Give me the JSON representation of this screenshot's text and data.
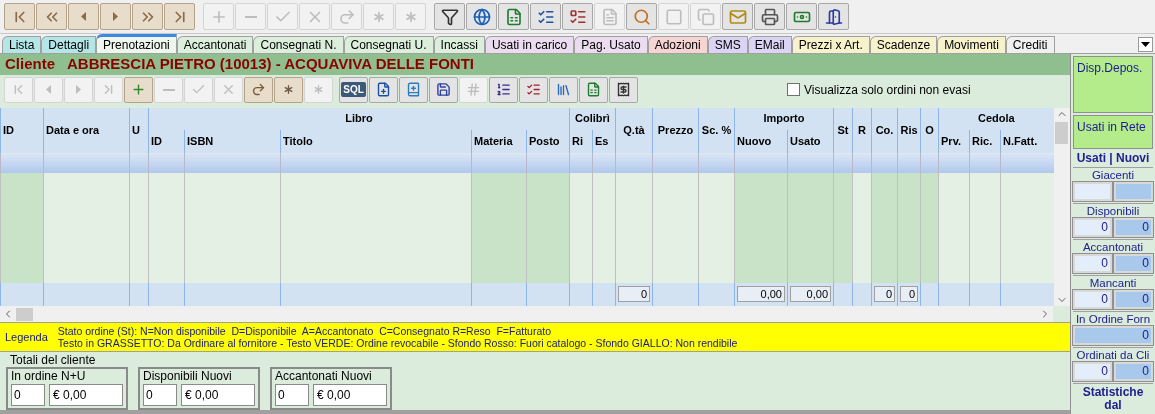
{
  "toolbar": {
    "buttons": [
      {
        "disabled": false
      },
      {
        "disabled": false
      },
      {
        "disabled": false
      },
      {
        "disabled": false
      },
      {
        "disabled": false
      },
      {
        "disabled": false
      },
      {
        "disabled": true
      },
      {
        "disabled": true
      },
      {
        "disabled": true
      },
      {
        "disabled": true
      },
      {
        "disabled": true
      },
      {
        "disabled": true
      },
      {
        "disabled": true
      },
      {
        "disabled": false
      },
      {
        "disabled": false
      },
      {
        "disabled": false
      },
      {
        "disabled": false
      },
      {
        "disabled": false
      },
      {
        "disabled": true
      },
      {
        "disabled": false
      },
      {
        "disabled": true
      },
      {
        "disabled": true
      },
      {
        "disabled": false
      },
      {
        "disabled": false
      },
      {
        "disabled": false
      },
      {
        "disabled": false
      }
    ]
  },
  "tabs": [
    {
      "label": "Lista",
      "selected": false,
      "color": "#b4e6e8"
    },
    {
      "label": "Dettagli",
      "selected": false,
      "color": "#b4e6e8"
    },
    {
      "label": "Prenotazioni",
      "selected": true,
      "color": "#eef6ee"
    },
    {
      "label": "Accantonati",
      "selected": false,
      "color": "#dcefdc"
    },
    {
      "label": "Consegnati N.",
      "selected": false,
      "color": "#dcefdc"
    },
    {
      "label": "Consegnati U.",
      "selected": false,
      "color": "#dcefdc"
    },
    {
      "label": "Incassi",
      "selected": false,
      "color": "#dcefdc"
    },
    {
      "label": "Usati in carico",
      "selected": false,
      "color": "#ecdcf0"
    },
    {
      "label": "Pag. Usato",
      "selected": false,
      "color": "#ecdcf0"
    },
    {
      "label": "Adozioni",
      "selected": false,
      "color": "#f6d4d4"
    },
    {
      "label": "SMS",
      "selected": false,
      "color": "#dcd4f4"
    },
    {
      "label": "EMail",
      "selected": false,
      "color": "#dcd4f4"
    },
    {
      "label": "Prezzi x Art.",
      "selected": false,
      "color": "#f6f2cc"
    },
    {
      "label": "Scadenze",
      "selected": false,
      "color": "#f6f2cc"
    },
    {
      "label": "Movimenti",
      "selected": false,
      "color": "#f6f2cc"
    },
    {
      "label": "Crediti",
      "selected": false,
      "color": "#f0f0f0"
    }
  ],
  "header": {
    "label": "Cliente",
    "customer": "ABBRESCIA PIETRO (10013) - ACQUAVIVA DELLE FONTI"
  },
  "record_toolbar": {
    "buttons": [
      {
        "disabled": true
      },
      {
        "disabled": true
      },
      {
        "disabled": true
      },
      {
        "disabled": true
      },
      {
        "disabled": false
      },
      {
        "disabled": true
      },
      {
        "disabled": true
      },
      {
        "disabled": true
      },
      {
        "disabled": false
      },
      {
        "disabled": false
      },
      {
        "disabled": true
      },
      {
        "label": "SQL",
        "disabled": false
      },
      {
        "disabled": false
      },
      {
        "disabled": false
      },
      {
        "disabled": false
      },
      {
        "disabled": true
      },
      {
        "disabled": false
      },
      {
        "disabled": false
      },
      {
        "disabled": false
      },
      {
        "disabled": false
      },
      {
        "disabled": false
      }
    ],
    "checkbox": {
      "label": "Visualizza solo ordini non evasi",
      "checked": false
    }
  },
  "table": {
    "columns": [
      {
        "label": "ID",
        "shaded": true
      },
      {
        "label": "Data e ora",
        "shaded": false
      },
      {
        "label": "U",
        "shaded": false
      },
      {
        "label": "Libro",
        "children": [
          {
            "label": "ID",
            "shaded": false
          },
          {
            "label": "ISBN",
            "shaded": false
          },
          {
            "label": "Titolo",
            "shaded": false
          },
          {
            "label": "Materia",
            "shaded": true
          },
          {
            "label": "Posto",
            "shaded": true
          }
        ]
      },
      {
        "label": "Colibrì",
        "children": [
          {
            "label": "Ri",
            "shaded": false
          },
          {
            "label": "Es",
            "shaded": false
          }
        ]
      },
      {
        "label": "Q.tà",
        "shaded": false,
        "total": "0"
      },
      {
        "label": "Prezzo",
        "shaded": false
      },
      {
        "label": "Sc. %",
        "shaded": false
      },
      {
        "label": "Importo",
        "children": [
          {
            "label": "Nuovo",
            "shaded": true,
            "total": "0,00"
          },
          {
            "label": "Usato",
            "shaded": true,
            "total": "0,00"
          }
        ]
      },
      {
        "label": "St",
        "shaded": true
      },
      {
        "label": "R",
        "shaded": false
      },
      {
        "label": "Co.",
        "shaded": true,
        "total": "0"
      },
      {
        "label": "Ris",
        "shaded": true,
        "total": "0"
      },
      {
        "label": "O",
        "shaded": true
      },
      {
        "label": "Cedola",
        "children": [
          {
            "label": "Prv.",
            "shaded": false
          },
          {
            "label": "Ric.",
            "shaded": false
          },
          {
            "label": "N.Fatt.",
            "shaded": false
          }
        ]
      }
    ]
  },
  "legend": {
    "label": "Legenda",
    "lines": [
      "Stato ordine (St): N=Non disponibile  D=Disponibile  A=Accantonato  C=Consegnato R=Reso  F=Fatturato",
      "Testo in GRASSETTO: Da Ordinare al fornitore - Testo VERDE: Ordine revocabile - Sfondo Rosso: Fuori catalogo - Sfondo GIALLO: Non rendibile"
    ]
  },
  "totals": {
    "title": "Totali del cliente",
    "groups": [
      {
        "label": "In ordine N+U",
        "quantity": "0",
        "amount": "€ 0,00"
      },
      {
        "label": "Disponibili Nuovi",
        "quantity": "0",
        "amount": "€ 0,00"
      },
      {
        "label": "Accantonati Nuovi",
        "quantity": "0",
        "amount": "€ 0,00"
      }
    ]
  },
  "side_panel": {
    "buttons": [
      "Disp.Depos.",
      "Usati in Rete"
    ],
    "header": "Usati | Nuovi",
    "groups": [
      {
        "label": "Giacenti",
        "fields": [
          {
            "kind": "usati"
          },
          {
            "kind": "nuovi"
          }
        ]
      },
      {
        "label": "Disponibili",
        "fields": [
          {
            "kind": "usati",
            "value": "0"
          },
          {
            "kind": "nuovi",
            "value": "0"
          }
        ]
      },
      {
        "label": "Accantonati",
        "fields": [
          {
            "kind": "usati",
            "value": "0"
          },
          {
            "kind": "nuovi",
            "value": "0"
          }
        ]
      },
      {
        "label": "Mancanti",
        "fields": [
          {
            "kind": "usati",
            "value": "0"
          },
          {
            "kind": "nuovi",
            "value": "0"
          }
        ]
      },
      {
        "label": "In Ordine Forn",
        "fields": [
          {
            "kind": "nuovi",
            "value": "0"
          }
        ]
      },
      {
        "label": "Ordinati da Cli",
        "fields": [
          {
            "kind": "usati",
            "value": "0"
          },
          {
            "kind": "nuovi",
            "value": "0"
          }
        ]
      }
    ],
    "footer": "Statistiche dal"
  }
}
